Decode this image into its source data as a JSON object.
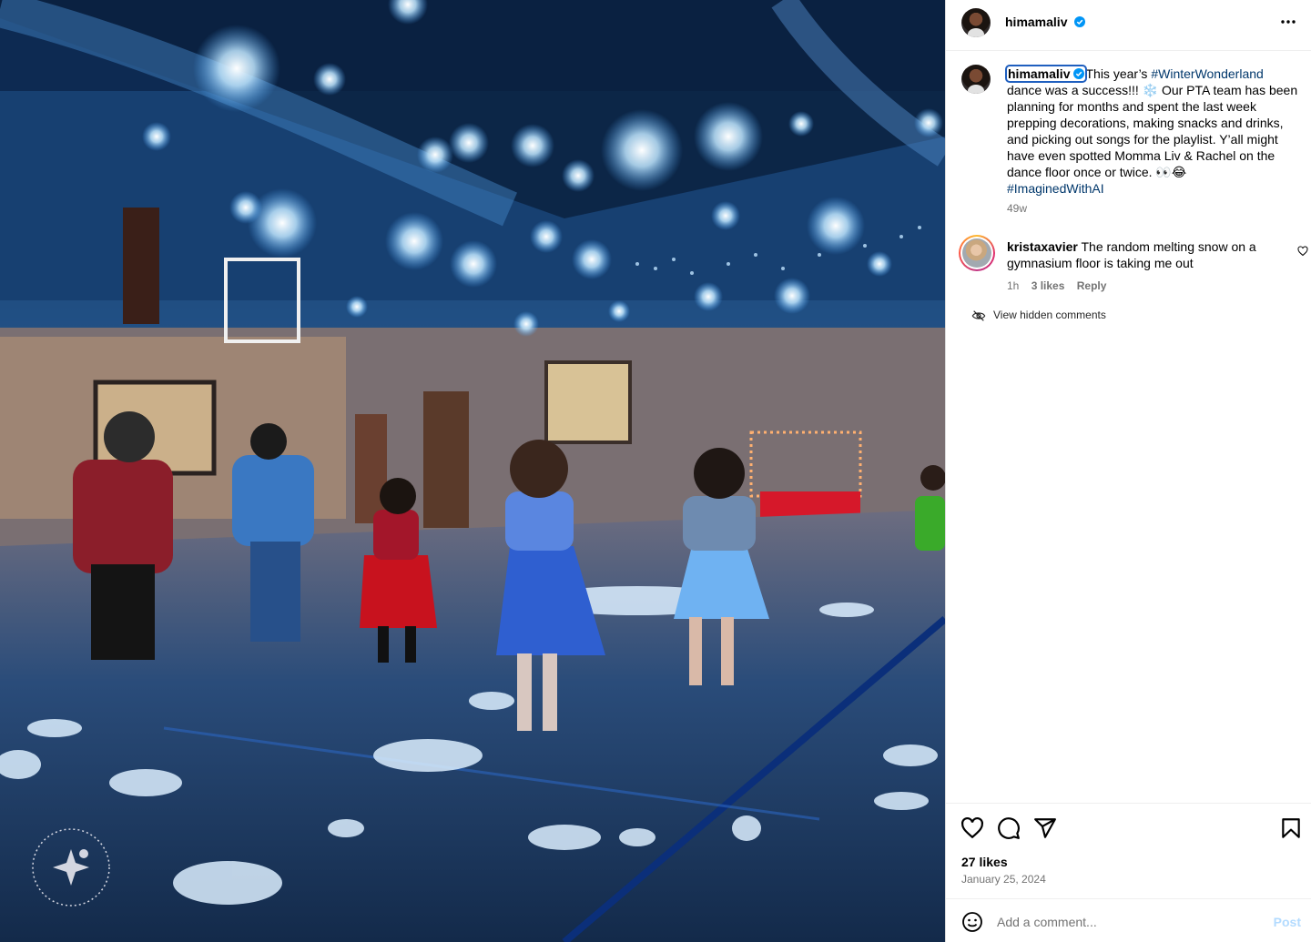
{
  "post": {
    "username": "himamaliv",
    "verified": true,
    "caption_prefix": "This year’s ",
    "hashtag1": "#WinterWonderland",
    "caption_body": " dance was a success!!! ❄️ Our PTA team has been planning for months and spent the last week prepping decorations, making snacks and drinks, and picking out songs for the playlist. Y’all might have even spotted Momma Liv & Rachel on the dance floor once or twice. 👀😂",
    "hashtag2": "#ImaginedWithAI",
    "time_ago": "49w",
    "likes": "27 likes",
    "date": "January 25, 2024",
    "image_watermark": "IMAGINED WITH AI • IMAGINED WITH AI •"
  },
  "comments": [
    {
      "username": "kristaxavier",
      "text": "The random melting snow on a gymnasium floor is taking me out",
      "time_ago": "1h",
      "likes": "3 likes",
      "reply_label": "Reply"
    }
  ],
  "view_hidden_label": "View hidden comments",
  "composer": {
    "placeholder": "Add a comment...",
    "post_label": "Post"
  },
  "icons": {
    "more": "more-horizontal-icon",
    "like": "heart-icon",
    "comment": "comment-icon",
    "share": "send-icon",
    "save": "bookmark-icon",
    "emoji": "emoji-icon",
    "hidden": "eye-slash-icon"
  },
  "colors": {
    "hashtag": "#00376b",
    "verified": "#0095f6",
    "muted": "#737373",
    "post_disabled": "#b3dbff"
  }
}
